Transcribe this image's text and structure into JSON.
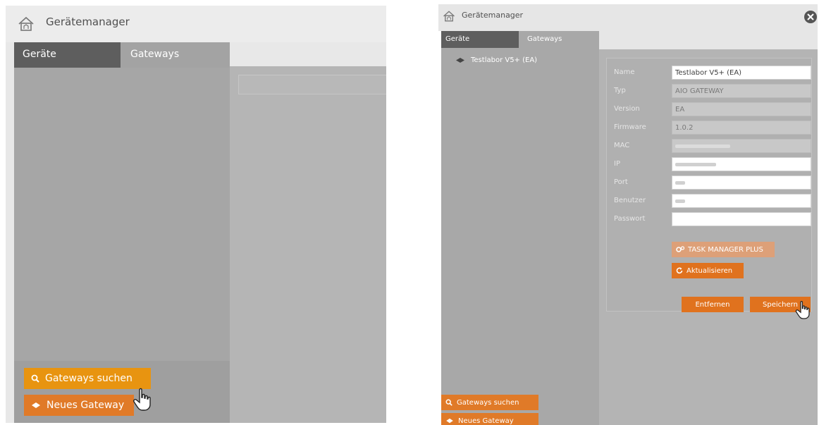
{
  "left": {
    "window": {
      "title": "Gerätemanager"
    },
    "tabs": [
      "Geräte",
      "Gateways"
    ],
    "active_tab": "Geräte",
    "buttons": {
      "search_gateways": "Gateways suchen",
      "new_gateway": "Neues Gateway"
    }
  },
  "right": {
    "window": {
      "title": "Gerätemanager"
    },
    "tabs": [
      "Geräte",
      "Gateways"
    ],
    "active_tab": "Geräte",
    "gateway_list": [
      {
        "name": "Testlabor V5+ (EA)",
        "icon": "gateway-icon"
      }
    ],
    "form": {
      "fields": [
        {
          "label": "Name",
          "value": "Testlabor V5+ (EA)",
          "editable": true
        },
        {
          "label": "Typ",
          "value": "AIO GATEWAY",
          "editable": false
        },
        {
          "label": "Version",
          "value": "EA",
          "editable": false
        },
        {
          "label": "Firmware",
          "value": "1.0.2",
          "editable": false
        },
        {
          "label": "MAC",
          "value": "",
          "editable": false,
          "obscured": true
        },
        {
          "label": "IP",
          "value": "",
          "editable": true,
          "obscured": true
        },
        {
          "label": "Port",
          "value": "",
          "editable": true,
          "obscured": true
        },
        {
          "label": "Benutzer",
          "value": "",
          "editable": true,
          "obscured": true
        },
        {
          "label": "Passwort",
          "value": "",
          "editable": true
        }
      ],
      "task_manager_label": "TASK MANAGER PLUS",
      "refresh_label": "Aktualisieren",
      "remove_label": "Entfernen",
      "save_label": "Speichern"
    },
    "buttons": {
      "search_gateways": "Gateways suchen",
      "new_gateway": "Neues Gateway"
    }
  },
  "colors": {
    "accent_orange": "#e07a28",
    "search_orange": "#e89410",
    "tab_active": "#5e5e5e",
    "sidebar_gray": "#a6a6a6"
  }
}
